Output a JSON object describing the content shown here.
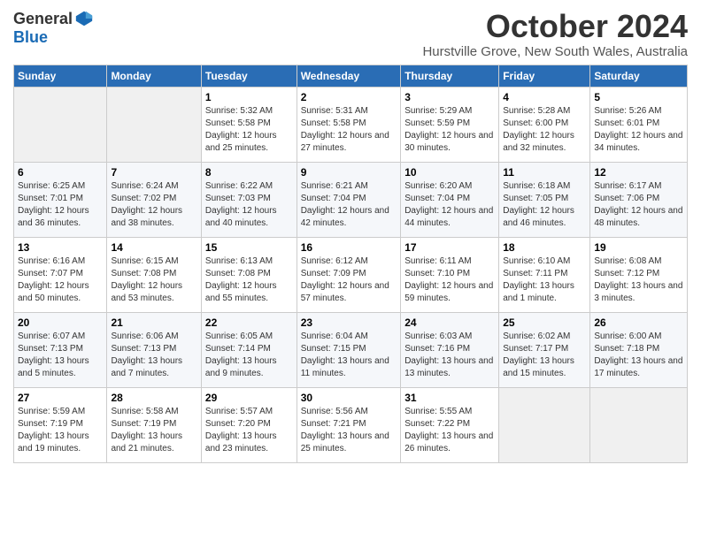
{
  "logo": {
    "general": "General",
    "blue": "Blue"
  },
  "title": "October 2024",
  "subtitle": "Hurstville Grove, New South Wales, Australia",
  "days_header": [
    "Sunday",
    "Monday",
    "Tuesday",
    "Wednesday",
    "Thursday",
    "Friday",
    "Saturday"
  ],
  "weeks": [
    [
      {
        "day": "",
        "empty": true
      },
      {
        "day": "",
        "empty": true
      },
      {
        "day": "1",
        "sunrise": "5:32 AM",
        "sunset": "5:58 PM",
        "daylight": "12 hours and 25 minutes."
      },
      {
        "day": "2",
        "sunrise": "5:31 AM",
        "sunset": "5:58 PM",
        "daylight": "12 hours and 27 minutes."
      },
      {
        "day": "3",
        "sunrise": "5:29 AM",
        "sunset": "5:59 PM",
        "daylight": "12 hours and 30 minutes."
      },
      {
        "day": "4",
        "sunrise": "5:28 AM",
        "sunset": "6:00 PM",
        "daylight": "12 hours and 32 minutes."
      },
      {
        "day": "5",
        "sunrise": "5:26 AM",
        "sunset": "6:01 PM",
        "daylight": "12 hours and 34 minutes."
      }
    ],
    [
      {
        "day": "6",
        "sunrise": "6:25 AM",
        "sunset": "7:01 PM",
        "daylight": "12 hours and 36 minutes."
      },
      {
        "day": "7",
        "sunrise": "6:24 AM",
        "sunset": "7:02 PM",
        "daylight": "12 hours and 38 minutes."
      },
      {
        "day": "8",
        "sunrise": "6:22 AM",
        "sunset": "7:03 PM",
        "daylight": "12 hours and 40 minutes."
      },
      {
        "day": "9",
        "sunrise": "6:21 AM",
        "sunset": "7:04 PM",
        "daylight": "12 hours and 42 minutes."
      },
      {
        "day": "10",
        "sunrise": "6:20 AM",
        "sunset": "7:04 PM",
        "daylight": "12 hours and 44 minutes."
      },
      {
        "day": "11",
        "sunrise": "6:18 AM",
        "sunset": "7:05 PM",
        "daylight": "12 hours and 46 minutes."
      },
      {
        "day": "12",
        "sunrise": "6:17 AM",
        "sunset": "7:06 PM",
        "daylight": "12 hours and 48 minutes."
      }
    ],
    [
      {
        "day": "13",
        "sunrise": "6:16 AM",
        "sunset": "7:07 PM",
        "daylight": "12 hours and 50 minutes."
      },
      {
        "day": "14",
        "sunrise": "6:15 AM",
        "sunset": "7:08 PM",
        "daylight": "12 hours and 53 minutes."
      },
      {
        "day": "15",
        "sunrise": "6:13 AM",
        "sunset": "7:08 PM",
        "daylight": "12 hours and 55 minutes."
      },
      {
        "day": "16",
        "sunrise": "6:12 AM",
        "sunset": "7:09 PM",
        "daylight": "12 hours and 57 minutes."
      },
      {
        "day": "17",
        "sunrise": "6:11 AM",
        "sunset": "7:10 PM",
        "daylight": "12 hours and 59 minutes."
      },
      {
        "day": "18",
        "sunrise": "6:10 AM",
        "sunset": "7:11 PM",
        "daylight": "13 hours and 1 minute."
      },
      {
        "day": "19",
        "sunrise": "6:08 AM",
        "sunset": "7:12 PM",
        "daylight": "13 hours and 3 minutes."
      }
    ],
    [
      {
        "day": "20",
        "sunrise": "6:07 AM",
        "sunset": "7:13 PM",
        "daylight": "13 hours and 5 minutes."
      },
      {
        "day": "21",
        "sunrise": "6:06 AM",
        "sunset": "7:13 PM",
        "daylight": "13 hours and 7 minutes."
      },
      {
        "day": "22",
        "sunrise": "6:05 AM",
        "sunset": "7:14 PM",
        "daylight": "13 hours and 9 minutes."
      },
      {
        "day": "23",
        "sunrise": "6:04 AM",
        "sunset": "7:15 PM",
        "daylight": "13 hours and 11 minutes."
      },
      {
        "day": "24",
        "sunrise": "6:03 AM",
        "sunset": "7:16 PM",
        "daylight": "13 hours and 13 minutes."
      },
      {
        "day": "25",
        "sunrise": "6:02 AM",
        "sunset": "7:17 PM",
        "daylight": "13 hours and 15 minutes."
      },
      {
        "day": "26",
        "sunrise": "6:00 AM",
        "sunset": "7:18 PM",
        "daylight": "13 hours and 17 minutes."
      }
    ],
    [
      {
        "day": "27",
        "sunrise": "5:59 AM",
        "sunset": "7:19 PM",
        "daylight": "13 hours and 19 minutes."
      },
      {
        "day": "28",
        "sunrise": "5:58 AM",
        "sunset": "7:19 PM",
        "daylight": "13 hours and 21 minutes."
      },
      {
        "day": "29",
        "sunrise": "5:57 AM",
        "sunset": "7:20 PM",
        "daylight": "13 hours and 23 minutes."
      },
      {
        "day": "30",
        "sunrise": "5:56 AM",
        "sunset": "7:21 PM",
        "daylight": "13 hours and 25 minutes."
      },
      {
        "day": "31",
        "sunrise": "5:55 AM",
        "sunset": "7:22 PM",
        "daylight": "13 hours and 26 minutes."
      },
      {
        "day": "",
        "empty": true
      },
      {
        "day": "",
        "empty": true
      }
    ]
  ],
  "labels": {
    "sunrise": "Sunrise:",
    "sunset": "Sunset:",
    "daylight": "Daylight:"
  }
}
